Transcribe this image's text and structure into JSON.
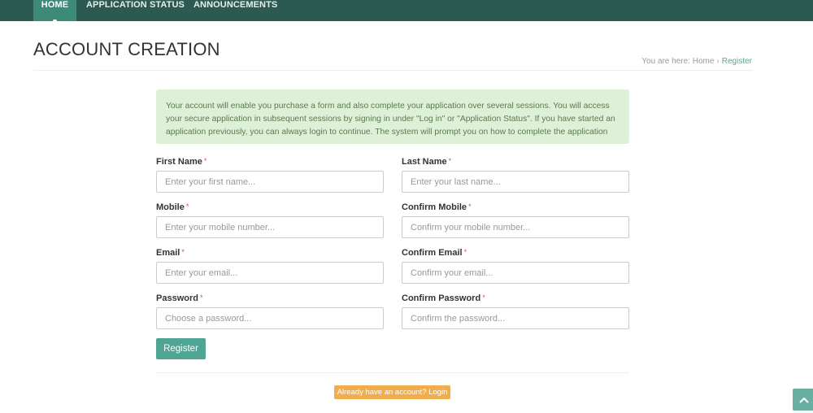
{
  "nav": {
    "items": [
      {
        "label": "HOME",
        "active": true
      },
      {
        "label": "APPLICATION STATUS",
        "active": false
      },
      {
        "label": "ANNOUNCEMENTS",
        "active": false
      }
    ]
  },
  "header": {
    "title": "ACCOUNT CREATION",
    "breadcrumb": {
      "prefix": "You are here:",
      "home": "Home",
      "separator": "›",
      "current": "Register"
    }
  },
  "alert": {
    "text": "Your account will enable you purchase a form and also complete your application over several sessions. You will access your secure application in subsequent sessions by signing in under \"Log in\" or \"Application Status\". If you have started an application previously, you can always login to continue. The system will prompt you on how to complete the application"
  },
  "form": {
    "required_marker": "*",
    "fields": {
      "first_name": {
        "label": "First Name",
        "placeholder": "Enter your first name..."
      },
      "last_name": {
        "label": "Last Name",
        "placeholder": "Enter your last name..."
      },
      "mobile": {
        "label": "Mobile",
        "placeholder": "Enter your mobile number..."
      },
      "confirm_mobile": {
        "label": "Confirm Mobile",
        "placeholder": "Confirm your mobile number..."
      },
      "email": {
        "label": "Email",
        "placeholder": "Enter your email..."
      },
      "confirm_email": {
        "label": "Confirm Email",
        "placeholder": "Confirm your email..."
      },
      "password": {
        "label": "Password",
        "placeholder": "Choose a password..."
      },
      "confirm_password": {
        "label": "Confirm Password",
        "placeholder": "Confirm the password..."
      }
    },
    "register_label": "Register",
    "login_label": "Already have an account? Login"
  },
  "scroll_top": {
    "icon": "chevron-up-icon"
  },
  "colors": {
    "nav_bg": "#2c5a50",
    "nav_active": "#3e8a78",
    "primary": "#4fa493",
    "alert_bg": "#dff0d8",
    "warning": "#f0ad4e",
    "required": "#d9534f"
  }
}
